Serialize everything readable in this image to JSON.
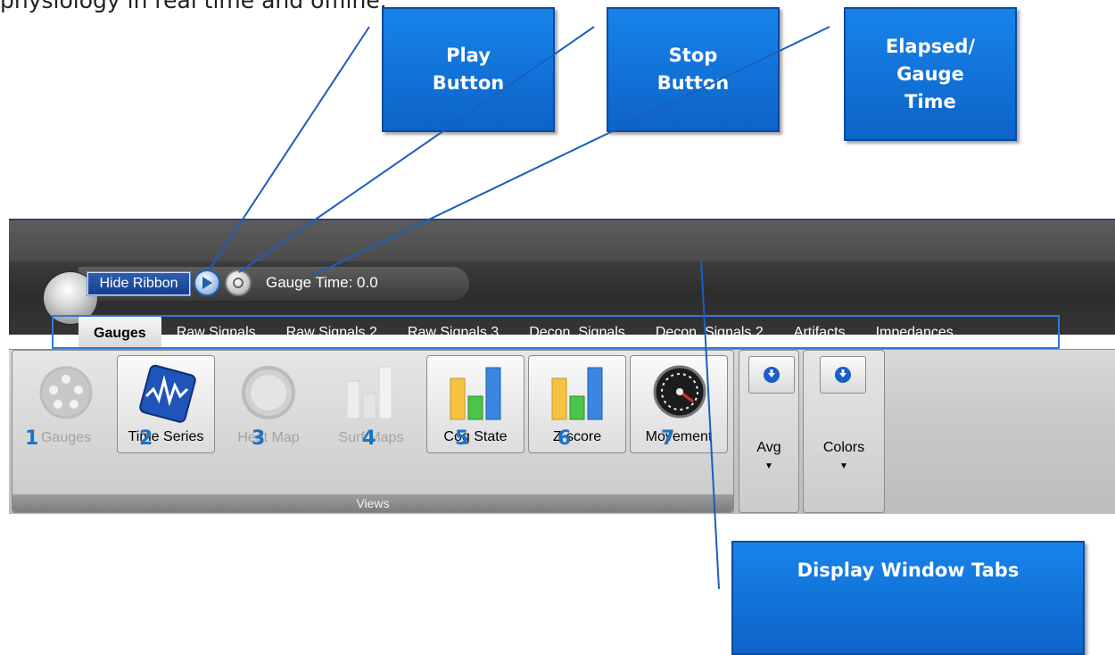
{
  "intro_text": "physiology in real time and offline.",
  "callouts": {
    "play": "Play\nButton",
    "stop": "Stop\nButton",
    "elapsed": "Elapsed/\nGauge\nTime",
    "tabs": "Display Window Tabs"
  },
  "toolbar": {
    "hide_ribbon": "Hide Ribbon",
    "gauge_time": "Gauge Time: 0.0"
  },
  "tabs": [
    "Gauges",
    "Raw Signals",
    "Raw Signals 2",
    "Raw Signals 3",
    "Decon. Signals",
    "Decon. Signals 2",
    "Artifacts",
    "Impedances"
  ],
  "views": {
    "group_label": "Views",
    "buttons": [
      {
        "num": "1",
        "label": "Gauges",
        "state": "disabled",
        "icon": "gauges-icon"
      },
      {
        "num": "2",
        "label": "Time Series",
        "state": "selected",
        "icon": "time-series-icon"
      },
      {
        "num": "3",
        "label": "Heat Map",
        "state": "disabled",
        "icon": "heat-map-icon"
      },
      {
        "num": "4",
        "label": "Surf Maps",
        "state": "disabled",
        "icon": "surf-maps-icon"
      },
      {
        "num": "5",
        "label": "Cog State",
        "state": "enabled",
        "icon": "cog-state-icon"
      },
      {
        "num": "6",
        "label": "Z-score",
        "state": "enabled",
        "icon": "z-score-icon"
      },
      {
        "num": "7",
        "label": "Movement",
        "state": "enabled",
        "icon": "movement-icon"
      }
    ]
  },
  "avg": {
    "label": "Avg",
    "arrow": "▼"
  },
  "colors": {
    "label": "Colors",
    "arrow": "▼"
  },
  "colors_map": {
    "accent": "#1b72c9",
    "callout": "#1477e0",
    "highlight": "#2f7ad8"
  }
}
